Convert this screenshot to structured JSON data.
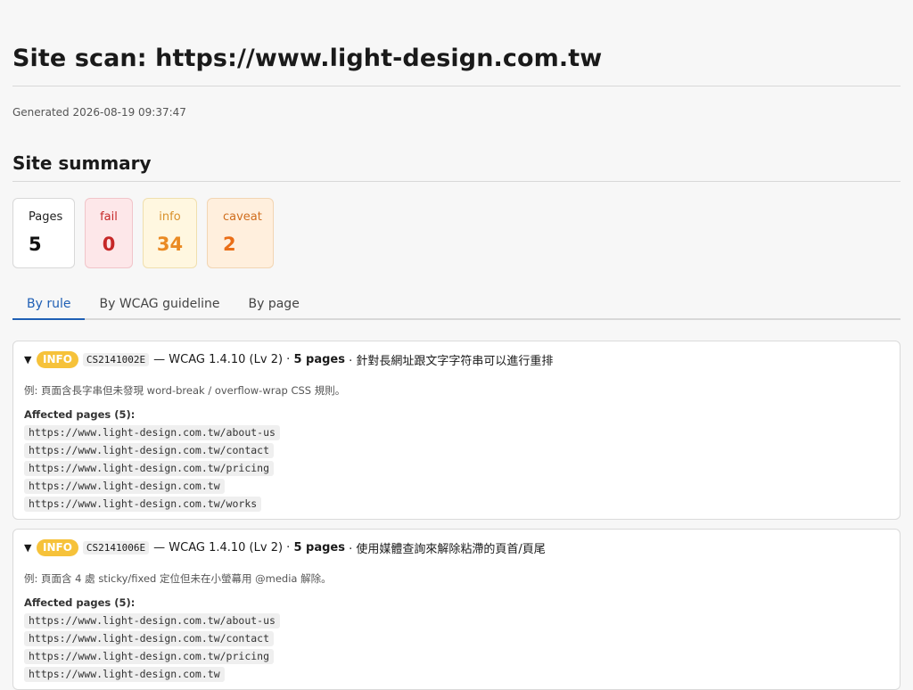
{
  "header": {
    "title": "Site scan: https://www.light-design.com.tw",
    "generated": "Generated 2026-08-19 09:37:47"
  },
  "summary": {
    "heading": "Site summary",
    "cards": [
      {
        "label": "Pages",
        "value": "5"
      },
      {
        "label": "fail",
        "value": "0"
      },
      {
        "label": "info",
        "value": "34"
      },
      {
        "label": "caveat",
        "value": "2"
      }
    ]
  },
  "tabs": [
    {
      "label": "By rule",
      "active": true
    },
    {
      "label": "By WCAG guideline",
      "active": false
    },
    {
      "label": "By page",
      "active": false
    }
  ],
  "rules": [
    {
      "toggle": "▼",
      "badge": "INFO",
      "code": "CS2141002E",
      "wcag": "— WCAG 1.4.10 (Lv 2) ·",
      "pages": "5 pages",
      "desc": "· 針對長網址跟文字字符串可以進行重排",
      "example": "例: 頁面含長字串但未發現 word-break / overflow-wrap CSS 規則。",
      "affected_label": "Affected pages (5):",
      "urls": [
        "https://www.light-design.com.tw/about-us",
        "https://www.light-design.com.tw/contact",
        "https://www.light-design.com.tw/pricing",
        "https://www.light-design.com.tw",
        "https://www.light-design.com.tw/works"
      ]
    },
    {
      "toggle": "▼",
      "badge": "INFO",
      "code": "CS2141006E",
      "wcag": "— WCAG 1.4.10 (Lv 2) ·",
      "pages": "5 pages",
      "desc": "· 使用媒體查詢來解除粘滯的頁首/頁尾",
      "example": "例: 頁面含 4 處 sticky/fixed 定位但未在小螢幕用 @media 解除。",
      "affected_label": "Affected pages (5):",
      "urls": [
        "https://www.light-design.com.tw/about-us",
        "https://www.light-design.com.tw/contact",
        "https://www.light-design.com.tw/pricing",
        "https://www.light-design.com.tw"
      ]
    }
  ]
}
